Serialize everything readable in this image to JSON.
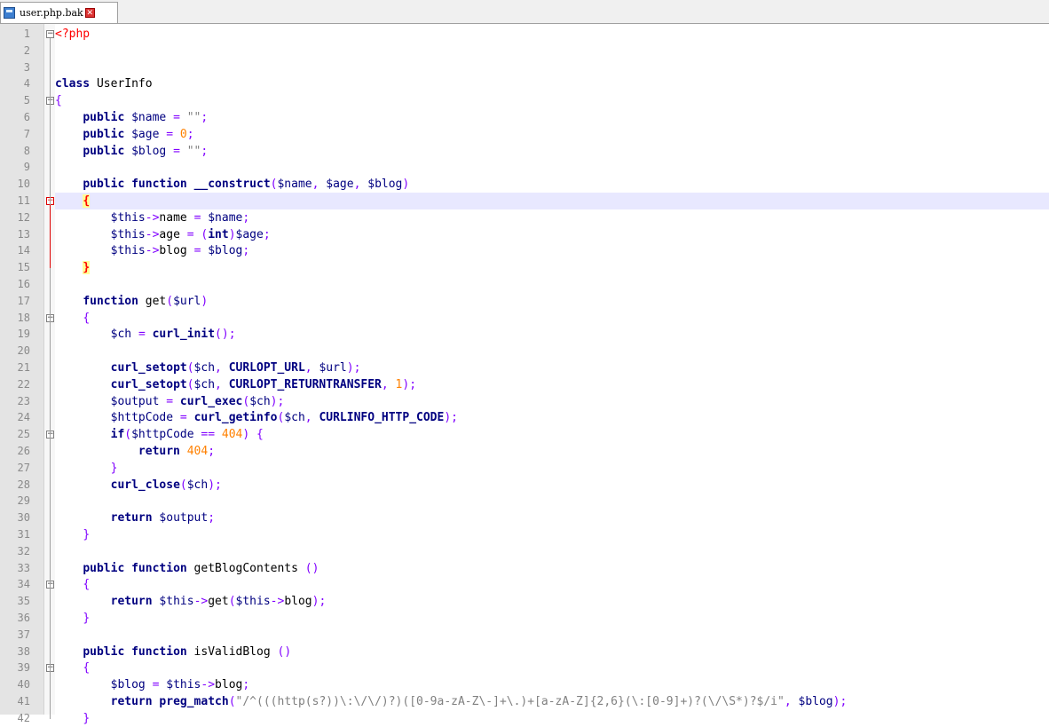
{
  "tab": {
    "label": "user.php.bak"
  },
  "lines": [
    {
      "n": "1",
      "text": "<?php"
    },
    {
      "n": "2",
      "text": ""
    },
    {
      "n": "3",
      "text": ""
    },
    {
      "n": "4",
      "text": "class UserInfo"
    },
    {
      "n": "5",
      "text": "{"
    },
    {
      "n": "6",
      "text": "    public $name = \"\";"
    },
    {
      "n": "7",
      "text": "    public $age = 0;"
    },
    {
      "n": "8",
      "text": "    public $blog = \"\";"
    },
    {
      "n": "9",
      "text": ""
    },
    {
      "n": "10",
      "text": "    public function __construct($name, $age, $blog)"
    },
    {
      "n": "11",
      "text": "    {"
    },
    {
      "n": "12",
      "text": "        $this->name = $name;"
    },
    {
      "n": "13",
      "text": "        $this->age = (int)$age;"
    },
    {
      "n": "14",
      "text": "        $this->blog = $blog;"
    },
    {
      "n": "15",
      "text": "    }"
    },
    {
      "n": "16",
      "text": ""
    },
    {
      "n": "17",
      "text": "    function get($url)"
    },
    {
      "n": "18",
      "text": "    {"
    },
    {
      "n": "19",
      "text": "        $ch = curl_init();"
    },
    {
      "n": "20",
      "text": ""
    },
    {
      "n": "21",
      "text": "        curl_setopt($ch, CURLOPT_URL, $url);"
    },
    {
      "n": "22",
      "text": "        curl_setopt($ch, CURLOPT_RETURNTRANSFER, 1);"
    },
    {
      "n": "23",
      "text": "        $output = curl_exec($ch);"
    },
    {
      "n": "24",
      "text": "        $httpCode = curl_getinfo($ch, CURLINFO_HTTP_CODE);"
    },
    {
      "n": "25",
      "text": "        if($httpCode == 404) {"
    },
    {
      "n": "26",
      "text": "            return 404;"
    },
    {
      "n": "27",
      "text": "        }"
    },
    {
      "n": "28",
      "text": "        curl_close($ch);"
    },
    {
      "n": "29",
      "text": ""
    },
    {
      "n": "30",
      "text": "        return $output;"
    },
    {
      "n": "31",
      "text": "    }"
    },
    {
      "n": "32",
      "text": ""
    },
    {
      "n": "33",
      "text": "    public function getBlogContents ()"
    },
    {
      "n": "34",
      "text": "    {"
    },
    {
      "n": "35",
      "text": "        return $this->get($this->blog);"
    },
    {
      "n": "36",
      "text": "    }"
    },
    {
      "n": "37",
      "text": ""
    },
    {
      "n": "38",
      "text": "    public function isValidBlog ()"
    },
    {
      "n": "39",
      "text": "    {"
    },
    {
      "n": "40",
      "text": "        $blog = $this->blog;"
    },
    {
      "n": "41",
      "text": "        return preg_match(\"/^(((http(s?))\\:\\/\\/)?)([0-9a-zA-Z\\-]+\\.)+[a-zA-Z]{2,6}(\\:[0-9]+)?(\\/\\S*)?$/i\", $blog);"
    },
    {
      "n": "42",
      "text": "    }"
    }
  ]
}
